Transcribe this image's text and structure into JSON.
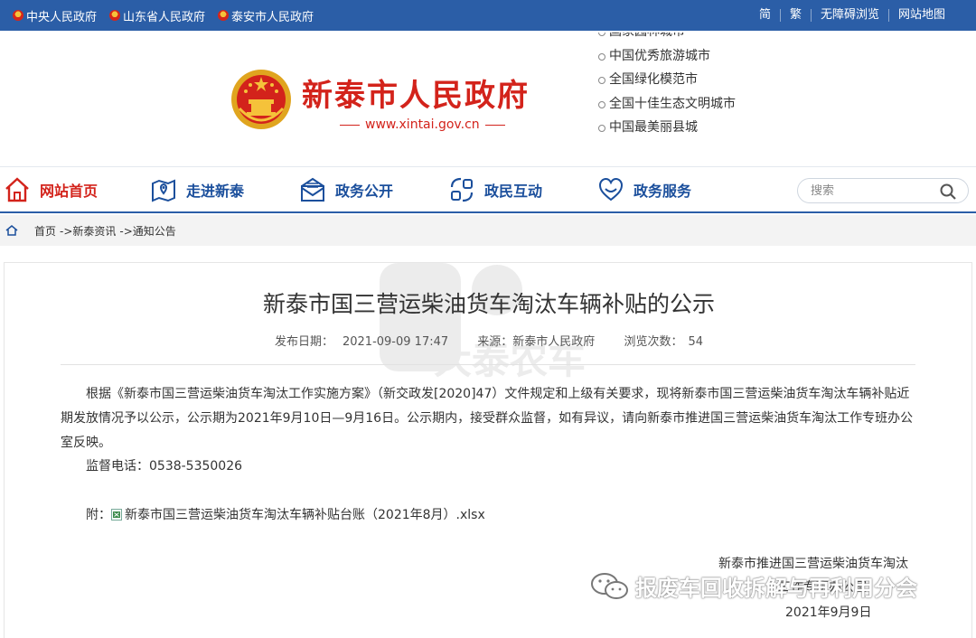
{
  "topbar": {
    "links": [
      "中央人民政府",
      "山东省人民政府",
      "泰安市人民政府"
    ],
    "right": [
      "简",
      "繁",
      "无障碍浏览",
      "网站地图"
    ]
  },
  "header": {
    "title": "新泰市人民政府",
    "url": "www.xintai.gov.cn",
    "honors": [
      "国家园林城市",
      "中国优秀旅游城市",
      "全国绿化模范市",
      "全国十佳生态文明城市",
      "中国最美丽县城"
    ]
  },
  "nav": {
    "items": [
      "网站首页",
      "走进新泰",
      "政务公开",
      "政民互动",
      "政务服务"
    ],
    "search_placeholder": "搜索"
  },
  "breadcrumb": [
    "首页",
    "->新泰资讯",
    "->通知公告"
  ],
  "article": {
    "title": "新泰市国三营运柴油货车淘汰车辆补贴的公示",
    "publish_label": "发布日期：",
    "publish_date": "2021-09-09 17:47",
    "source_label": "来源：",
    "source": "新泰市人民政府",
    "views_label": "浏览次数：",
    "views": "54",
    "body": "根据《新泰市国三营运柴油货车淘汰工作实施方案》（新交政发[2020]47）文件规定和上级有关要求，现将新泰市国三营运柴油货车淘汰车辆补贴近期发放情况予以公示，公示期为2021年9月10日—9月16日。公示期内，接受群众监督，如有异议，请向新泰市推进国三营运柴油货车淘汰工作专班办公室反映。",
    "phone": "监督电话：0538-5350026",
    "attach_label": "附：",
    "attachment": "新泰市国三营运柴油货车淘汰车辆补贴台账（2021年8月）.xlsx",
    "signature_line1": "新泰市推进国三营运柴油货车淘汰",
    "signature_line2": "工作专班办公室",
    "signature_date": "2021年9月9日"
  },
  "watermarks": {
    "wechat": "报废车回收拆解与再利用分会",
    "site": "大泰农车"
  },
  "colors": {
    "topbar": "#2b5ea7",
    "brand_red": "#d3231b",
    "nav_blue": "#1b4f9c"
  }
}
